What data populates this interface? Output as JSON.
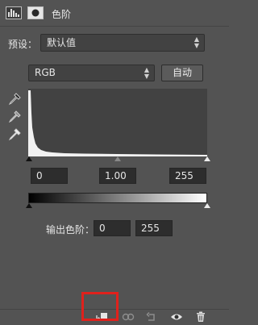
{
  "panel": {
    "title": "色阶",
    "icons": [
      "histogram-icon",
      "mask-icon"
    ]
  },
  "preset": {
    "label": "预设：",
    "value": "默认值"
  },
  "channel": {
    "value": "RGB",
    "auto_label": "自动"
  },
  "input_levels": {
    "black": "0",
    "gamma": "1.00",
    "white": "255"
  },
  "output_levels": {
    "label": "输出色阶：",
    "black": "0",
    "white": "255"
  },
  "bottom_icons": [
    "clip-to-layer-icon",
    "view-previous-state-icon",
    "reset-icon",
    "visibility-icon",
    "delete-icon"
  ],
  "colors": {
    "panel_bg": "#535353",
    "highlight": "#e0211c"
  }
}
